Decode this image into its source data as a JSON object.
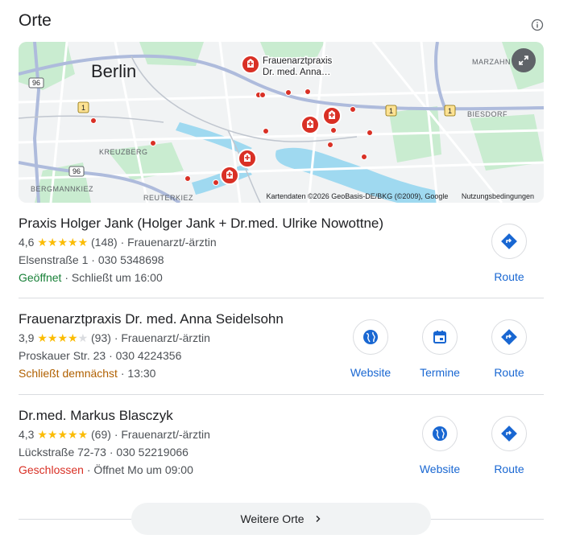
{
  "header": {
    "title": "Orte",
    "info_icon": "info-icon"
  },
  "map": {
    "city_label": "Berlin",
    "labels": {
      "kreuzberg": "KREUZBERG",
      "bergmannkiez": "BERGMANNKIEZ",
      "reuterkiez": "REUTERKIEZ",
      "marzahn": "MARZAHN",
      "biesdorf": "BIESDORF"
    },
    "road_badges": {
      "b96_top": "96",
      "b96_bottom": "96",
      "b1_left": "1",
      "b1_mid": "1",
      "b1_right": "1"
    },
    "callout_line1": "Frauenarztpraxis",
    "callout_line2": "Dr. med. Anna…",
    "attribution": "Kartendaten ©2026 GeoBasis-DE/BKG (©2009), Google",
    "terms": "Nutzungsbedingungen",
    "expand_icon": "expand-icon",
    "colors": {
      "park": "#c9ecd0",
      "water": "#9fd9f0",
      "road": "#ffffff",
      "highway": "#aebbdc",
      "marker": "#d93025"
    }
  },
  "places": [
    {
      "name": "Praxis Holger Jank (Holger Jank + Dr.med. Ulrike Nowottne)",
      "rating": "4,6",
      "stars_full": "★★★★",
      "stars_half": "★",
      "stars_empty": "",
      "review_count": "(148)",
      "category": "Frauenarzt/-ärztin",
      "address": "Elsenstraße 1",
      "phone": "030 5348698",
      "status": "Geöffnet",
      "status_detail": "Schließt um 16:00",
      "route_label": "Route"
    },
    {
      "name": "Frauenarztpraxis Dr. med. Anna Seidelsohn",
      "rating": "3,9",
      "stars_full": "★★★★",
      "stars_half": "",
      "stars_empty": "★",
      "review_count": "(93)",
      "category": "Frauenarzt/-ärztin",
      "address": "Proskauer Str. 23",
      "phone": "030 4224356",
      "status": "Schließt demnächst",
      "status_detail": "13:30",
      "website_label": "Website",
      "appointment_label": "Termine",
      "route_label": "Route"
    },
    {
      "name": "Dr.med. Markus Blasczyk",
      "rating": "4,3",
      "stars_full": "★★★★",
      "stars_half": "★",
      "stars_empty": "",
      "review_count": "(69)",
      "category": "Frauenarzt/-ärztin",
      "address": "Lückstraße 72-73",
      "phone": "030 52219066",
      "status": "Geschlossen",
      "status_detail": "Öffnet Mo um 09:00",
      "website_label": "Website",
      "route_label": "Route"
    }
  ],
  "separator": "·",
  "more_button": {
    "label": "Weitere Orte",
    "icon": "chevron-right-icon"
  }
}
